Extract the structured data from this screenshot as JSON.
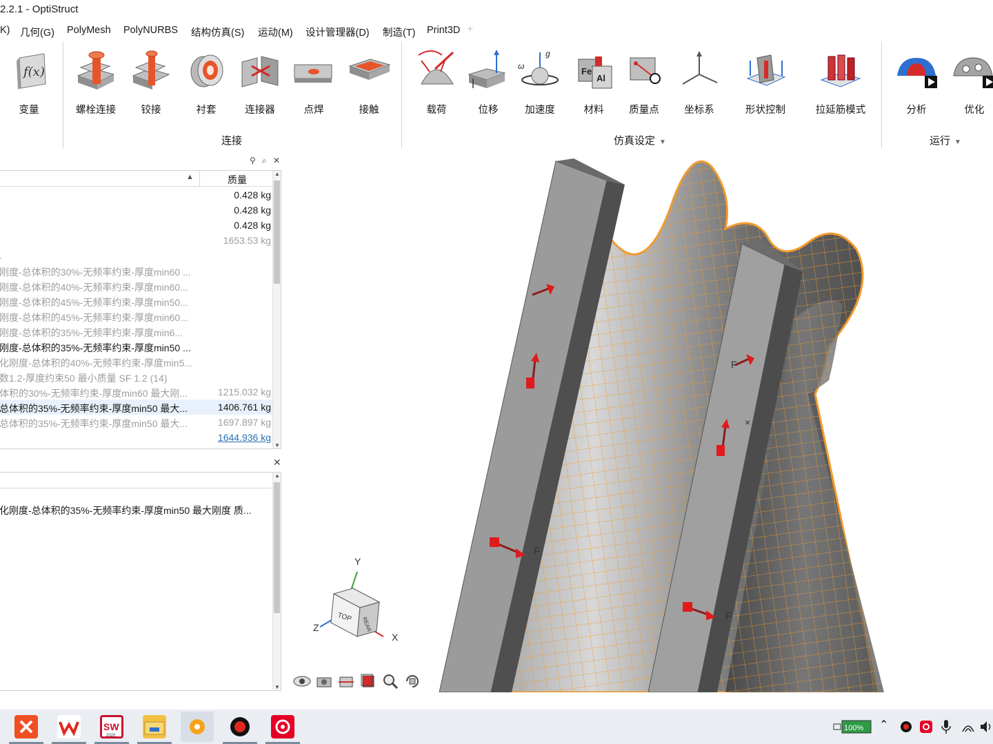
{
  "app": {
    "title": "2.2.1 - OptiStruct"
  },
  "menu": [
    {
      "label": "K)"
    },
    {
      "label": "几何(G)"
    },
    {
      "label": "PolyMesh"
    },
    {
      "label": "PolyNURBS"
    },
    {
      "label": "结构仿真(S)",
      "active": true
    },
    {
      "label": "运动(M)"
    },
    {
      "label": "设计管理器(D)"
    },
    {
      "label": "制造(T)"
    },
    {
      "label": "Print3D"
    }
  ],
  "menu_plus": "+",
  "ribbon": {
    "buttons": [
      {
        "label": "变量",
        "icon": "variable-fx-icon"
      },
      {
        "label": "螺栓连接",
        "icon": "bolt-connection-icon"
      },
      {
        "label": "铰接",
        "icon": "hinge-icon"
      },
      {
        "label": "衬套",
        "icon": "bushing-icon"
      },
      {
        "label": "连接器",
        "icon": "connector-icon"
      },
      {
        "label": "点焊",
        "icon": "spot-weld-icon"
      },
      {
        "label": "接触",
        "icon": "contact-icon"
      },
      {
        "label": "载荷",
        "icon": "load-icon"
      },
      {
        "label": "位移",
        "icon": "displacement-icon"
      },
      {
        "label": "加速度",
        "icon": "acceleration-icon"
      },
      {
        "label": "材料",
        "icon": "material-icon"
      },
      {
        "label": "质量点",
        "icon": "mass-point-icon"
      },
      {
        "label": "坐标系",
        "icon": "coordinate-system-icon"
      },
      {
        "label": "形状控制",
        "icon": "shape-control-icon"
      },
      {
        "label": "拉延筋模式",
        "icon": "draw-bead-icon"
      },
      {
        "label": "分析",
        "icon": "analyze-icon"
      },
      {
        "label": "优化",
        "icon": "optimize-icon"
      }
    ],
    "groups": [
      {
        "label": "连接",
        "caret": ""
      },
      {
        "label": "仿真设定",
        "caret": "▼"
      },
      {
        "label": "运行",
        "caret": "▼"
      }
    ],
    "icon_text": {
      "fx": "f(x)",
      "g": "g",
      "omega": "ω",
      "fe": "Fe",
      "al": "Al"
    }
  },
  "panel_icons": {
    "binoculars": "⚲",
    "search": "⌕",
    "close": "✕"
  },
  "results": {
    "sort_indicator": "▲",
    "mass_header": "质量",
    "rows": [
      {
        "name": "",
        "mass": "0.428 kg",
        "style": "dark"
      },
      {
        "name": "",
        "mass": "0.428 kg",
        "style": "dark"
      },
      {
        "name": "",
        "mass": "0.428 kg",
        "style": "dark"
      },
      {
        "name": "",
        "mass": "1653.53 kg",
        "style": "dim"
      },
      {
        "name": ".",
        "mass": "",
        "style": "dim"
      },
      {
        "name": "刚度-总体积的30%-无频率约束-厚度min60 ...",
        "mass": "",
        "style": "dim"
      },
      {
        "name": "刚度-总体积的40%-无频率约束-厚度min60...",
        "mass": "",
        "style": "dim"
      },
      {
        "name": "刚度-总体积的45%-无频率约束-厚度min50...",
        "mass": "",
        "style": "dim"
      },
      {
        "name": "刚度-总体积的45%-无频率约束-厚度min60...",
        "mass": "",
        "style": "dim"
      },
      {
        "name": "刚度-总体积的35%-无频率约束-厚度min6...",
        "mass": "",
        "style": "dim"
      },
      {
        "name": "刚度-总体积的35%-无频率约束-厚度min50 ...",
        "mass": "",
        "style": "dark"
      },
      {
        "name": "化刚度-总体积的40%-无频率约束-厚度min5...",
        "mass": "",
        "style": "dim"
      },
      {
        "name": "数1.2-厚度约束50 最小质量 SF 1.2 (14)",
        "mass": "",
        "style": "dim"
      },
      {
        "name": "体积的30%-无频率约束-厚度min60 最大刚...",
        "mass": "1215.032 kg",
        "style": "dim"
      },
      {
        "name": "总体积的35%-无频率约束-厚度min50 最大...",
        "mass": "1406.761 kg",
        "style": "sel"
      },
      {
        "name": "总体积的35%-无频率约束-厚度min50 最大...",
        "mass": "1697.897 kg",
        "style": "dim"
      },
      {
        "name": "",
        "mass": "1644.936 kg",
        "style": "link"
      }
    ]
  },
  "detail": {
    "close": "✕",
    "text": "化刚度-总体积的35%-无频率约束-厚度min50 最大刚度 质..."
  },
  "viewport": {
    "force_label": "F",
    "axis_y": "Y",
    "axis_z": "Z",
    "axis_x": "X",
    "cube_top": "TOP",
    "cube_right": "REAR",
    "cube_front": "FRONT",
    "marker": "×"
  },
  "taskbar": {
    "apps": [
      {
        "name": "xmind-app",
        "color": "#f04e23"
      },
      {
        "name": "wps-app",
        "color": "#ffffff"
      },
      {
        "name": "solidworks-app",
        "color": "#c8102e"
      },
      {
        "name": "file-explorer-app",
        "color": "#f4c043"
      },
      {
        "name": "inspire-app",
        "color": "#f7a21b"
      },
      {
        "name": "record-app",
        "color": "#111111"
      },
      {
        "name": "netease-music-app",
        "color": "#e60026"
      }
    ],
    "battery": "100%",
    "sw_year": "2020"
  }
}
